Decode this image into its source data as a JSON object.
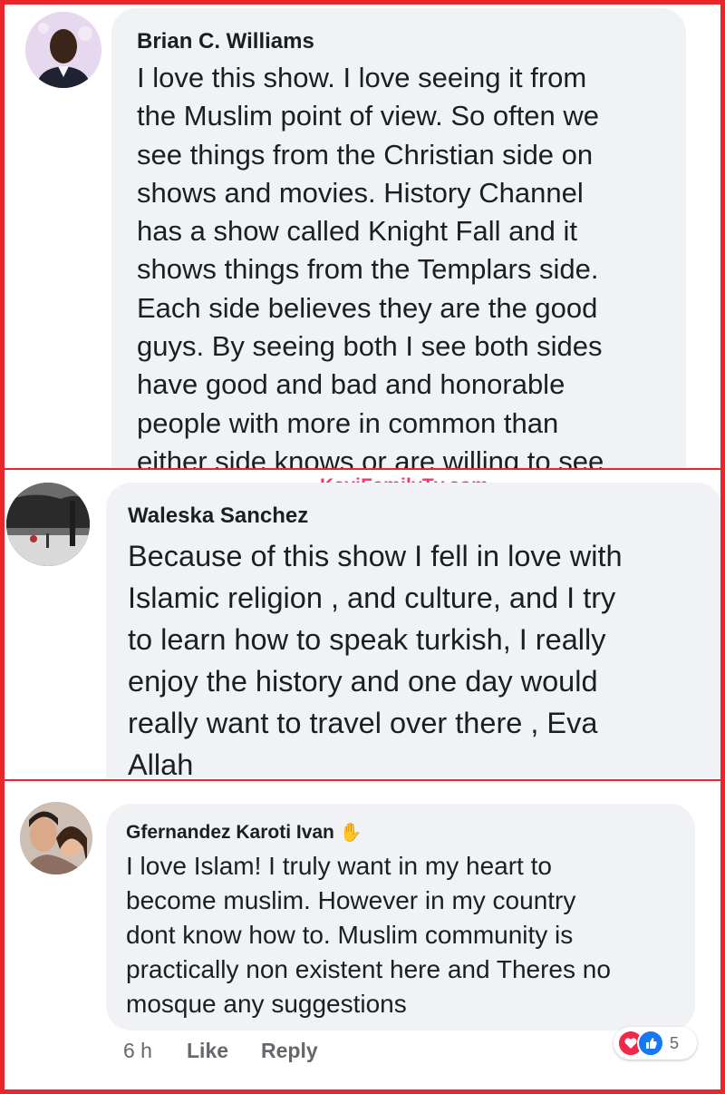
{
  "comments": [
    {
      "author": "Brian C. Williams",
      "lines": [
        "I love this show. I love seeing it from",
        "the Muslim point of view. So often we",
        "see things from the Christian side on",
        "shows and movies. History Channel",
        "has a show called Knight Fall and it",
        "shows things from the Templars side.",
        "Each side believes they are the good",
        "guys. By seeing both I see both sides",
        "have good and bad and honorable",
        "people with more in common than",
        "either side knows or are willing to see"
      ]
    },
    {
      "author": "Waleska Sanchez",
      "lines": [
        "Because of this show I fell in love with",
        "Islamic religion , and culture, and I try",
        "to learn how to speak turkish, I really",
        "enjoy the history and one day would",
        "really want to travel over there , Eva",
        "Allah"
      ]
    },
    {
      "author": "Gfernandez Karoti Ivan",
      "author_badge_icon": "waving-hand-icon",
      "lines": [
        "I love Islam! I truly want  in my heart to",
        "become muslim. However in my country",
        "dont know how to. Muslim community is",
        "practically non existent here and Theres no",
        "mosque any suggestions"
      ],
      "time": "6 h",
      "like_label": "Like",
      "reply_label": "Reply",
      "reaction_icons": [
        "love-reaction-icon",
        "like-reaction-icon"
      ],
      "reaction_count": "5"
    }
  ],
  "watermark": "KayiFamilyTv.com",
  "colors": {
    "frame": "#e8262c",
    "bubble": "#f0f2f5",
    "watermark": "#ff2f6d",
    "like_blue": "#1877f2",
    "love_red": "#f02849"
  }
}
